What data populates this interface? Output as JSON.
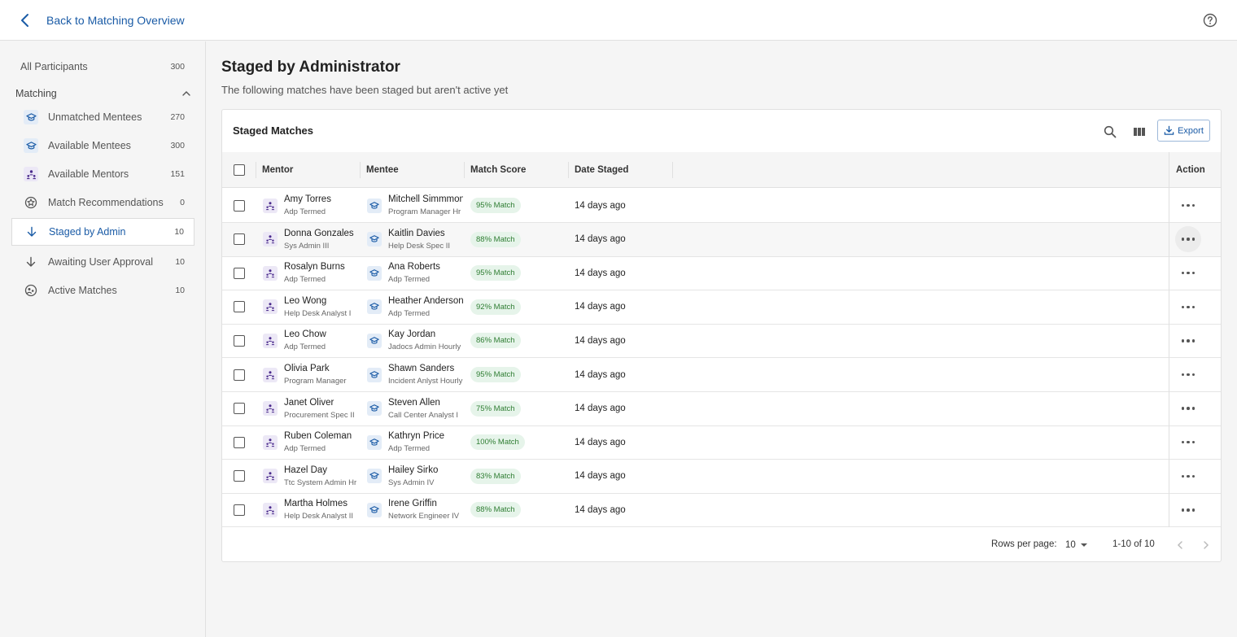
{
  "topbar": {
    "back_label": "Back to Matching Overview"
  },
  "sidebar": {
    "all_participants": {
      "label": "All Participants",
      "count": "300"
    },
    "section_title": "Matching",
    "items": [
      {
        "label": "Unmatched Mentees",
        "count": "270",
        "icon": "mentee-icon"
      },
      {
        "label": "Available Mentees",
        "count": "300",
        "icon": "mentee-icon"
      },
      {
        "label": "Available Mentors",
        "count": "151",
        "icon": "mentor-icon"
      },
      {
        "label": "Match Recommendations",
        "count": "0",
        "icon": "recommendation-icon"
      },
      {
        "label": "Staged by Admin",
        "count": "10",
        "icon": "arrow-down-icon"
      },
      {
        "label": "Awaiting User Approval",
        "count": "10",
        "icon": "arrow-down-icon"
      },
      {
        "label": "Active Matches",
        "count": "10",
        "icon": "active-matches-icon"
      }
    ]
  },
  "main": {
    "title": "Staged by Administrator",
    "subtitle": "The following matches have been staged but aren't active yet"
  },
  "table": {
    "title": "Staged Matches",
    "export_label": "Export",
    "headers": {
      "mentor": "Mentor",
      "mentee": "Mentee",
      "score": "Match Score",
      "date": "Date Staged",
      "action": "Action"
    },
    "rows": [
      {
        "mentor": "Amy Torres",
        "mentor_role": "Adp Termed",
        "mentee": "Mitchell Simmmons",
        "mentee_role": "Program Manager Hr",
        "score": "95% Match",
        "date": "14 days ago"
      },
      {
        "mentor": "Donna Gonzales",
        "mentor_role": "Sys Admin III",
        "mentee": "Kaitlin Davies",
        "mentee_role": "Help Desk Spec II",
        "score": "88% Match",
        "date": "14 days ago"
      },
      {
        "mentor": "Rosalyn Burns",
        "mentor_role": "Adp Termed",
        "mentee": "Ana Roberts",
        "mentee_role": "Adp Termed",
        "score": "95% Match",
        "date": "14 days ago"
      },
      {
        "mentor": "Leo Wong",
        "mentor_role": "Help Desk Analyst I",
        "mentee": "Heather Anderson",
        "mentee_role": "Adp Termed",
        "score": "92% Match",
        "date": "14 days ago"
      },
      {
        "mentor": "Leo Chow",
        "mentor_role": "Adp Termed",
        "mentee": "Kay Jordan",
        "mentee_role": "Jadocs Admin Hourly",
        "score": "86% Match",
        "date": "14 days ago"
      },
      {
        "mentor": "Olivia Park",
        "mentor_role": "Program Manager",
        "mentee": "Shawn Sanders",
        "mentee_role": "Incident Anlyst Hourly",
        "score": "95% Match",
        "date": "14 days ago"
      },
      {
        "mentor": "Janet Oliver",
        "mentor_role": "Procurement Spec II",
        "mentee": "Steven Allen",
        "mentee_role": "Call Center Analyst I",
        "score": "75% Match",
        "date": "14 days ago"
      },
      {
        "mentor": "Ruben Coleman",
        "mentor_role": "Adp Termed",
        "mentee": "Kathryn Price",
        "mentee_role": "Adp Termed",
        "score": "100% Match",
        "date": "14 days ago"
      },
      {
        "mentor": "Hazel Day",
        "mentor_role": "Ttc System Admin Hr",
        "mentee": "Hailey Sirko",
        "mentee_role": "Sys Admin IV",
        "score": "83% Match",
        "date": "14 days ago"
      },
      {
        "mentor": "Martha Holmes",
        "mentor_role": "Help Desk Analyst II",
        "mentee": "Irene Griffin",
        "mentee_role": "Network Engineer IV",
        "score": "88% Match",
        "date": "14 days ago"
      }
    ],
    "footer": {
      "rows_per_page_label": "Rows per page:",
      "rows_per_page": "10",
      "range": "1-10 of 10"
    }
  },
  "colors": {
    "accent": "#1a5ba6",
    "badge_bg": "#e6f4ea",
    "badge_text": "#2e7d32",
    "mentor_icon": "#4a2a8c",
    "mentee_icon": "#1a5ba6"
  }
}
